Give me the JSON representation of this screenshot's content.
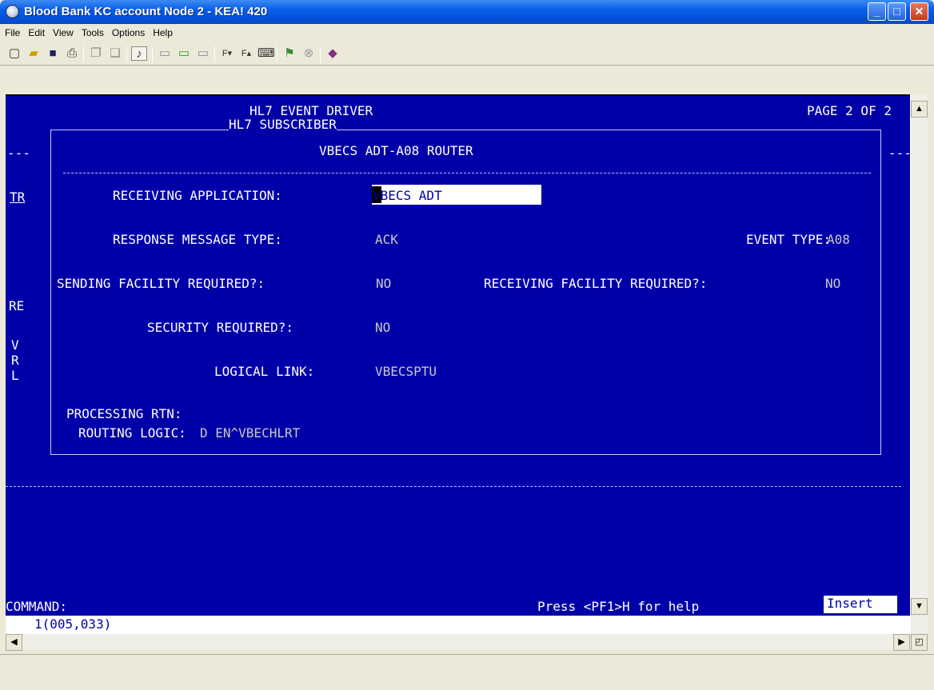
{
  "window": {
    "title": "Blood Bank KC account Node 2 - KEA! 420"
  },
  "menu": [
    "File",
    "Edit",
    "View",
    "Tools",
    "Options",
    "Help"
  ],
  "toolbar_icons": [
    "new-icon",
    "open-icon",
    "save-icon",
    "print-icon",
    "copy-icon",
    "paste-icon",
    "audio-icon",
    "folder-a-icon",
    "folder-b-icon",
    "folder-c-icon",
    "font-down-icon",
    "font-up-icon",
    "keyboard-icon",
    "signal-icon",
    "stop-icon",
    "book-icon"
  ],
  "terminal": {
    "header_title": "HL7 EVENT DRIVER",
    "page": "PAGE 2 OF 2",
    "popup_title": "HL7 SUBSCRIBER",
    "router_name": "VBECS ADT-A08 ROUTER",
    "left_dashes": "---",
    "right_dashes": "---",
    "left_fragments": {
      "tr": "TR",
      "re": "RE",
      "v": "V",
      "r": "R",
      "l": "L"
    },
    "receiving_application_label": "RECEIVING APPLICATION:",
    "receiving_application_value": "VBECS ADT",
    "response_message_type_label": "RESPONSE MESSAGE TYPE:",
    "response_message_type_value": "ACK",
    "event_type_label": "EVENT TYPE:",
    "event_type_value": "A08",
    "sending_facility_label": "SENDING FACILITY REQUIRED?:",
    "sending_facility_value": "NO",
    "receiving_facility_label": "RECEIVING FACILITY REQUIRED?:",
    "receiving_facility_value": "NO",
    "security_label": "SECURITY REQUIRED?:",
    "security_value": "NO",
    "logical_link_label": "LOGICAL LINK:",
    "logical_link_value": "VBECSPTU",
    "processing_rtn_label": "PROCESSING RTN:",
    "routing_logic_label": "ROUTING LOGIC:",
    "routing_logic_value": "D EN^VBECHLRT",
    "command_label": "COMMAND:",
    "help_text": "Press <PF1>H for help",
    "mode": "Insert",
    "cursor_position": "1(005,033)"
  }
}
